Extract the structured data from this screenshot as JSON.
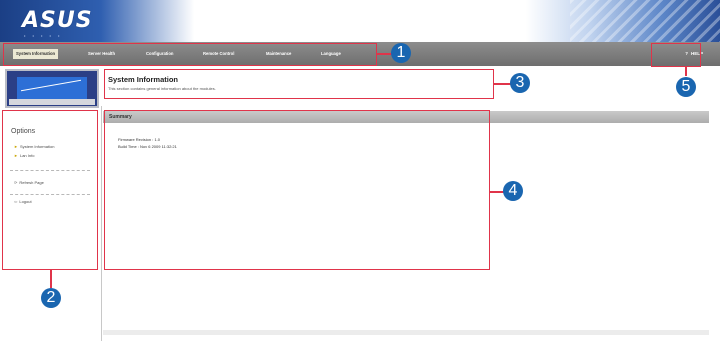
{
  "brand": {
    "logo_text": "ASUS"
  },
  "nav": {
    "items": [
      {
        "label": "System Information",
        "active": true
      },
      {
        "label": "Server Health",
        "active": false
      },
      {
        "label": "Configuration",
        "active": false
      },
      {
        "label": "Remote Control",
        "active": false
      },
      {
        "label": "Maintenance",
        "active": false
      },
      {
        "label": "Language",
        "active": false
      }
    ],
    "help_label": "HELP",
    "help_icon": "?"
  },
  "sidebar": {
    "title": "Options",
    "items": [
      {
        "label": "System Information",
        "icon": "arrow-bullet-icon"
      },
      {
        "label": "Lan Info",
        "icon": "arrow-bullet-icon"
      },
      {
        "label": "Refresh Page",
        "icon": "refresh-icon"
      },
      {
        "label": "Logout",
        "icon": "logout-icon"
      }
    ]
  },
  "header": {
    "title": "System Information",
    "description": "This section contains general information about the modules."
  },
  "summary": {
    "heading": "Summary",
    "firmware_revision": "Firmware Revision : 1.0",
    "build_time": "Build Time : Nov 6 2009 11:32:21"
  },
  "callouts": [
    "1",
    "2",
    "3",
    "4",
    "5"
  ],
  "colors": {
    "callout": "#e0344a",
    "badge": "#1a66b0",
    "nav": "#7d7d7d"
  }
}
